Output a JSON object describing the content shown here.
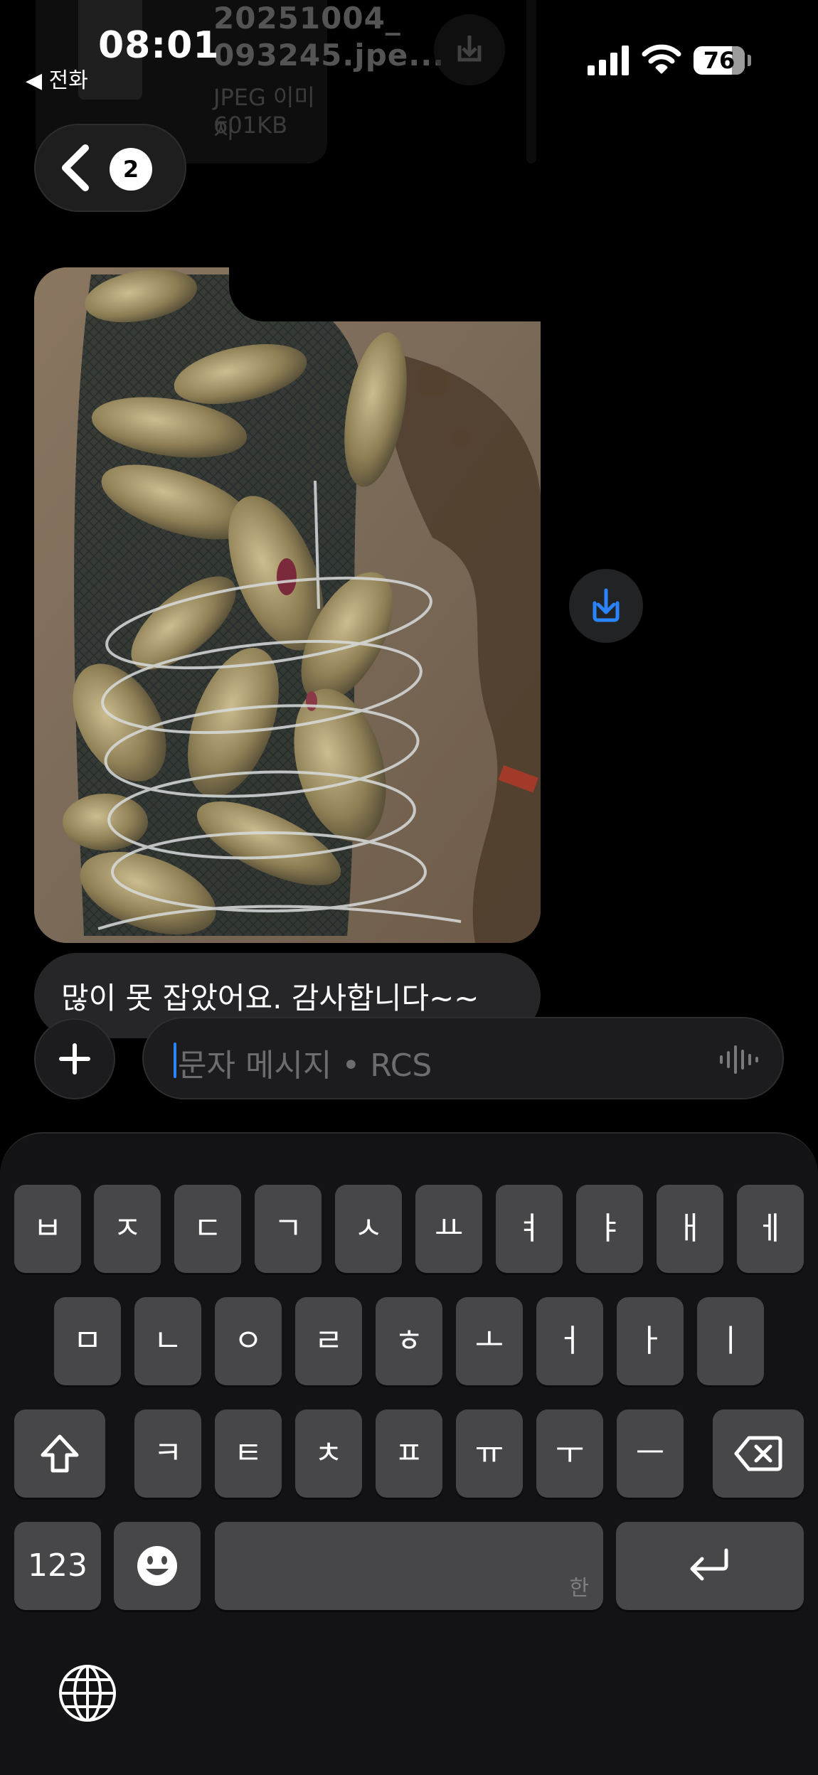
{
  "attachment": {
    "filename_line1": "20251004_",
    "filename_line2": "093245.jpe...",
    "filetype": "JPEG 이미지",
    "filesize": "601KB"
  },
  "status_bar": {
    "time": "08:01",
    "back_app": "◀ 전화",
    "battery": "76"
  },
  "nav": {
    "unread_count": "2"
  },
  "messages": [
    {
      "type": "image",
      "description_icon": "photo"
    },
    {
      "type": "text",
      "text": "많이 못 잡았어요. 감사합니다~~"
    }
  ],
  "composer": {
    "placeholder": "문자 메시지 • RCS"
  },
  "keyboard": {
    "row1": [
      "ㅂ",
      "ㅈ",
      "ㄷ",
      "ㄱ",
      "ㅅ",
      "ㅛ",
      "ㅕ",
      "ㅑ",
      "ㅐ",
      "ㅔ"
    ],
    "row2": [
      "ㅁ",
      "ㄴ",
      "ㅇ",
      "ㄹ",
      "ㅎ",
      "ㅗ",
      "ㅓ",
      "ㅏ",
      "ㅣ"
    ],
    "row3": [
      "ㅋ",
      "ㅌ",
      "ㅊ",
      "ㅍ",
      "ㅠ",
      "ㅜ",
      "ㅡ"
    ],
    "numbers_label": "123",
    "space_hint": "한"
  },
  "colors": {
    "accent": "#2b84ff",
    "key": "#474749",
    "keyboard_bg": "#131315"
  }
}
